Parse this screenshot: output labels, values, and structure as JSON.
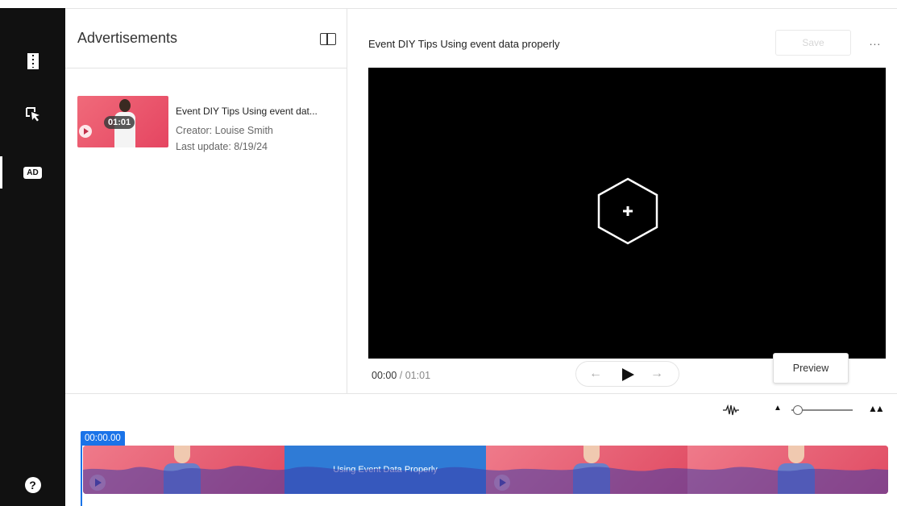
{
  "sidebar": {
    "items": [
      {
        "name": "media",
        "icon": "film-strip-icon",
        "active": false
      },
      {
        "name": "interactions",
        "icon": "cursor-click-icon",
        "active": false
      },
      {
        "name": "ads",
        "icon": "ad-icon",
        "label": "AD",
        "active": true
      }
    ],
    "help_label": "?"
  },
  "library": {
    "title": "Advertisements",
    "items": [
      {
        "title": "Event DIY Tips Using event dat...",
        "creator": "Creator: Louise Smith",
        "updated": "Last update: 8/19/24",
        "duration": "01:01"
      }
    ]
  },
  "editor": {
    "video_title": "Event DIY Tips Using event data properly",
    "save_label": "Save",
    "more_label": "...",
    "current_time": "00:00",
    "separator": "/",
    "total_time": "01:01",
    "preview_label": "Preview",
    "prev_arrow": "←",
    "next_arrow": "→"
  },
  "timeline": {
    "timecode": "00:00.00",
    "ad_segment_label": "Using Event Data Properly",
    "zoom_level": 0.1
  },
  "colors": {
    "accent": "#1a73e8",
    "ad_segment": "#2f7bd6",
    "rail": "#111111",
    "video_bg": "#000000"
  }
}
